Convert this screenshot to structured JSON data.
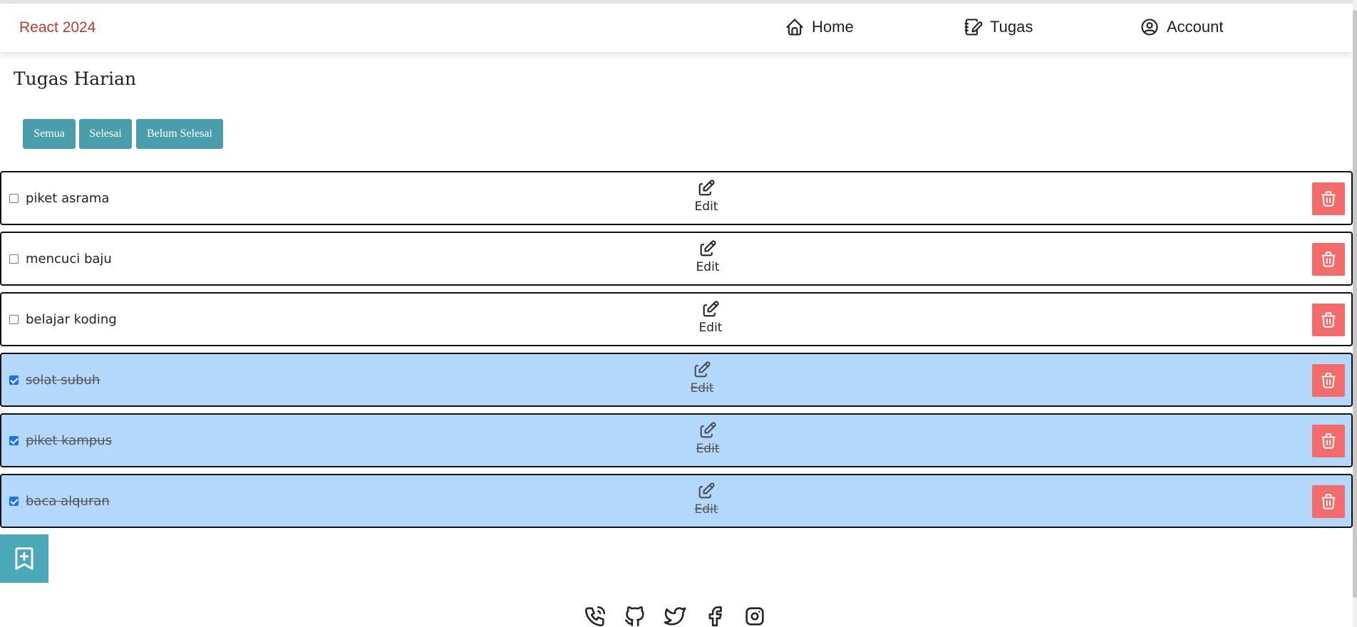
{
  "brand": "React 2024",
  "nav": {
    "home": "Home",
    "tugas": "Tugas",
    "account": "Account"
  },
  "page_title": "Tugas Harian",
  "filters": {
    "semua": "Semua",
    "selesai": "Selesai",
    "belum": "Belum Selesai"
  },
  "tasks": [
    {
      "label": "piket asrama",
      "done": false,
      "edit_label": "Edit"
    },
    {
      "label": "mencuci baju",
      "done": false,
      "edit_label": "Edit"
    },
    {
      "label": "belajar koding",
      "done": false,
      "edit_label": "Edit"
    },
    {
      "label": "solat subuh",
      "done": true,
      "edit_label": "Edit"
    },
    {
      "label": "piket kampus",
      "done": true,
      "edit_label": "Edit"
    },
    {
      "label": "baca alquran",
      "done": true,
      "edit_label": "Edit"
    }
  ],
  "icons": {
    "nav": [
      "home-icon",
      "notebook-edit-icon",
      "user-circle-icon"
    ],
    "task": [
      "edit-icon",
      "trash-icon"
    ],
    "add": "bookmark-plus-icon",
    "footer": [
      "phone-icon",
      "github-icon",
      "twitter-icon",
      "facebook-icon",
      "instagram-icon"
    ]
  },
  "colors": {
    "brand": "#c0392b",
    "filter_button": "#4a9eab",
    "done_row": "#b3d8fb",
    "delete_button": "#f36b6b",
    "add_button": "#4aa8b8"
  }
}
